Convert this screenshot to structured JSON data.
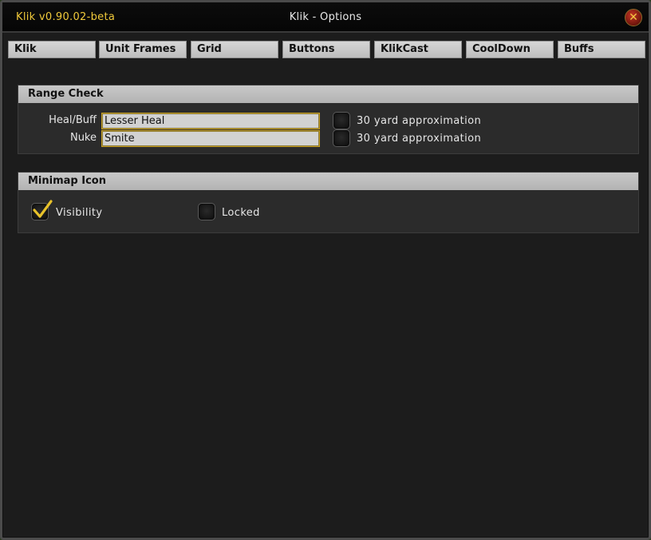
{
  "window": {
    "version": "Klik v0.90.02-beta",
    "title": "Klik - Options",
    "close_glyph": "✕"
  },
  "tabs": [
    {
      "label": "Klik"
    },
    {
      "label": "Unit Frames"
    },
    {
      "label": "Grid"
    },
    {
      "label": "Buttons"
    },
    {
      "label": "KlikCast"
    },
    {
      "label": "CoolDown"
    },
    {
      "label": "Buffs"
    }
  ],
  "range_check": {
    "header": "Range Check",
    "heal_label": "Heal/Buff",
    "heal_value": "Lesser Heal",
    "heal_approx_label": "30 yard approximation",
    "heal_approx_checked": false,
    "nuke_label": "Nuke",
    "nuke_value": "Smite",
    "nuke_approx_label": "30 yard approximation",
    "nuke_approx_checked": false
  },
  "minimap": {
    "header": "Minimap Icon",
    "visibility_label": "Visibility",
    "visibility_checked": true,
    "locked_label": "Locked",
    "locked_checked": false
  },
  "colors": {
    "version_text": "#f0c93a",
    "checkmark": "#e8c22a",
    "input_border": "#c9a022"
  }
}
